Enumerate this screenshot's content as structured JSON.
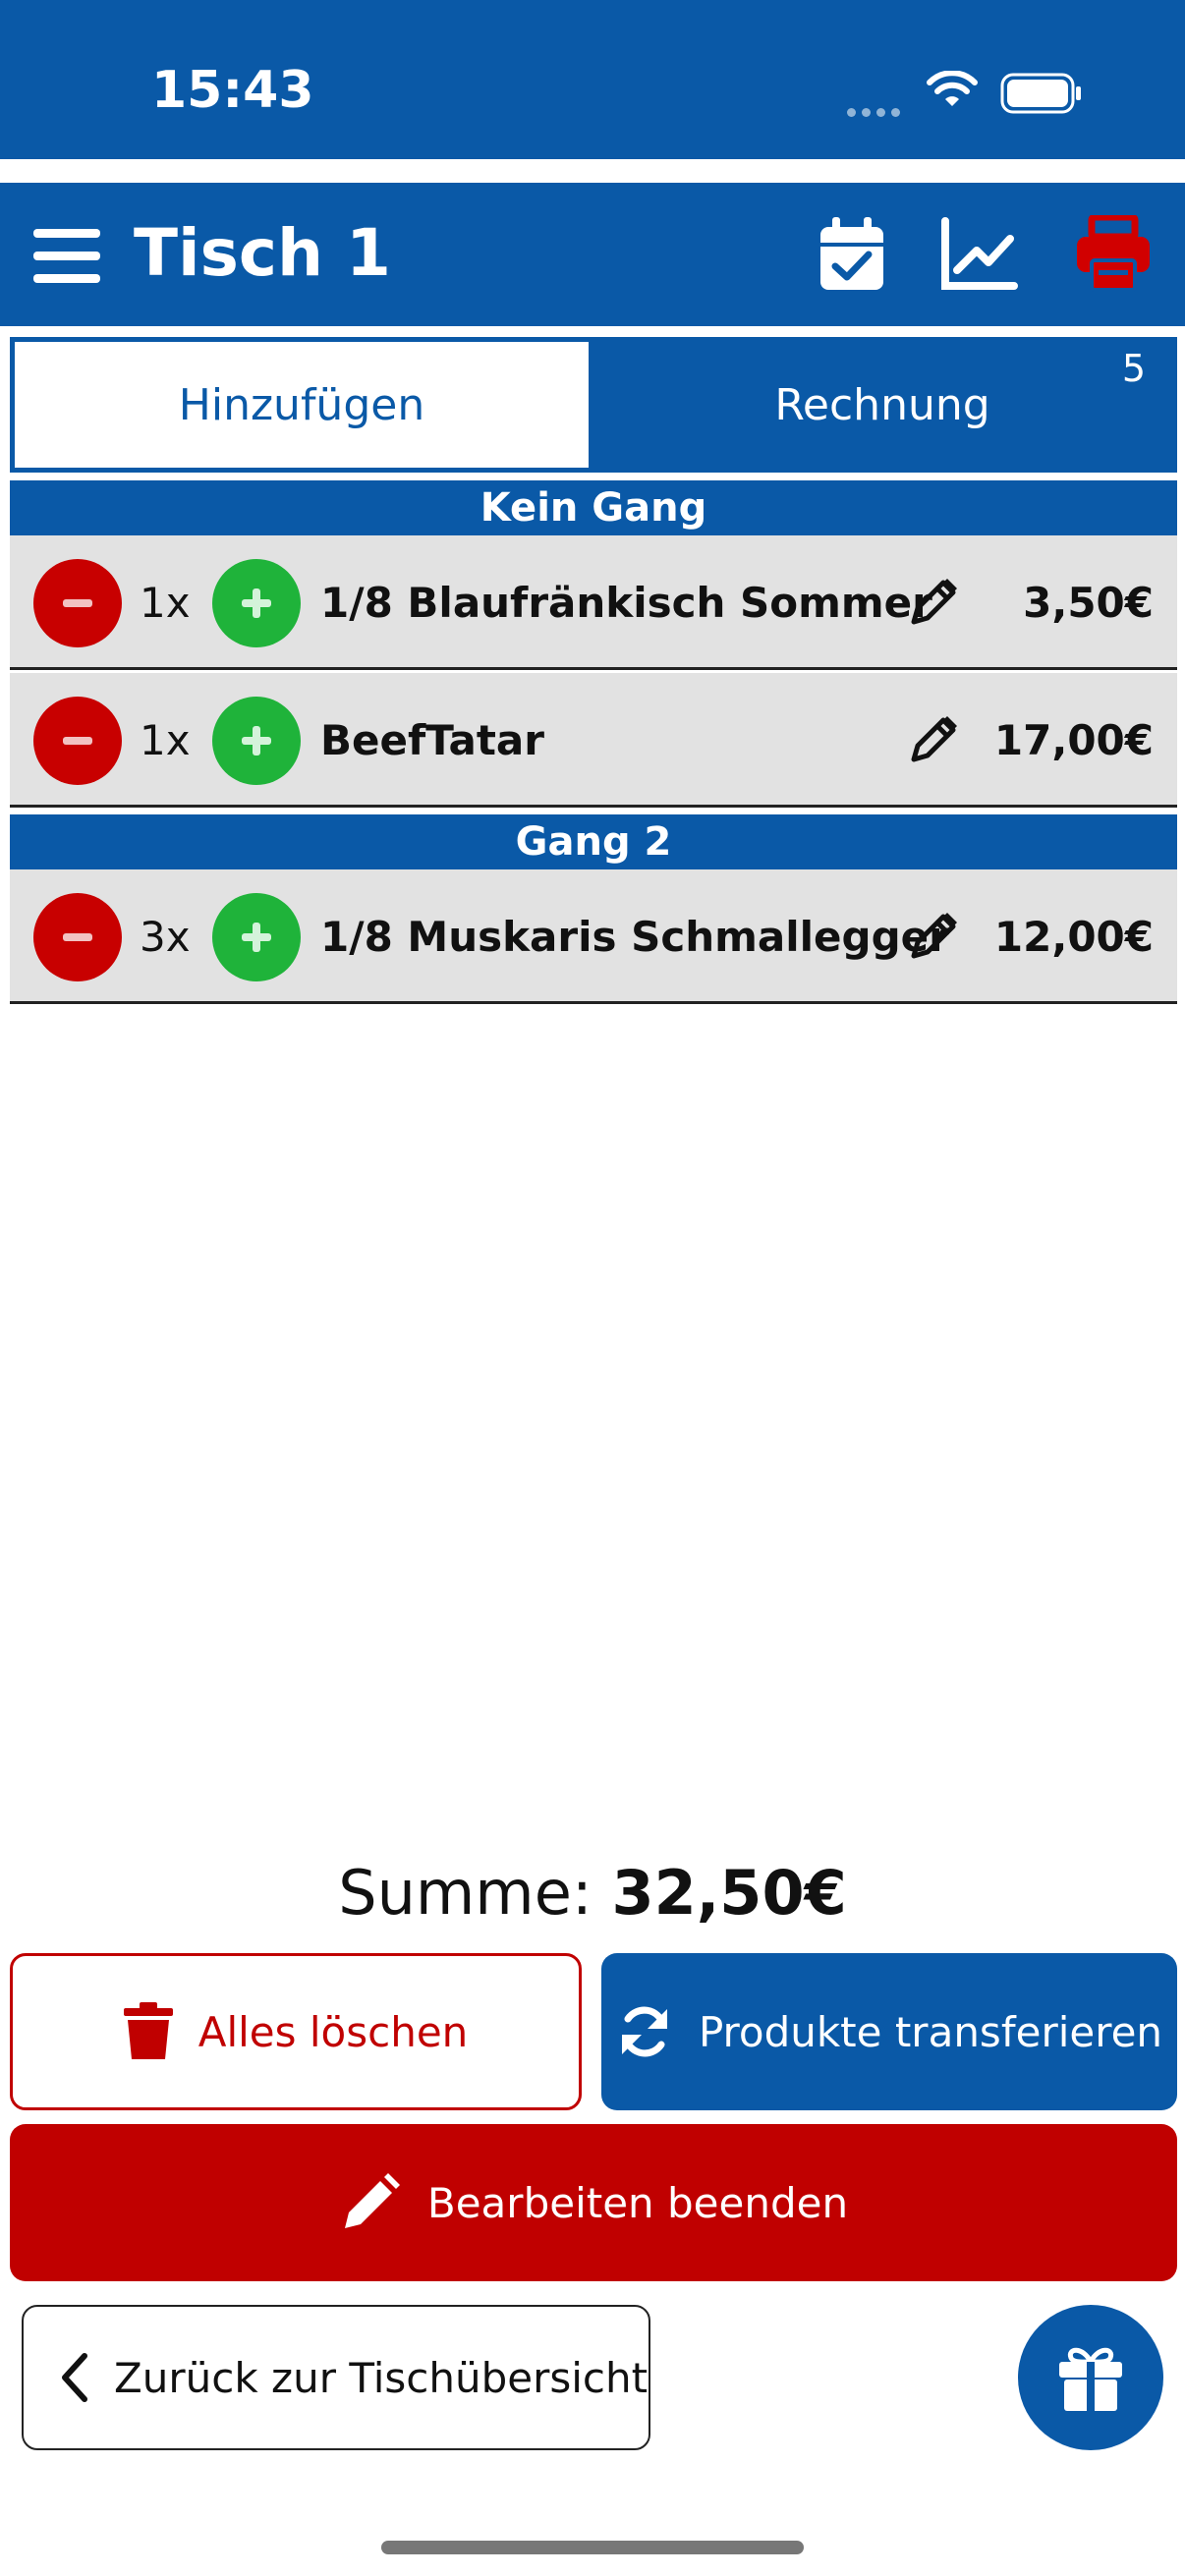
{
  "status_bar": {
    "time": "15:43"
  },
  "app_bar": {
    "title": "Tisch 1"
  },
  "tabs": [
    {
      "label": "Hinzufügen",
      "active": true
    },
    {
      "label": "Rechnung",
      "badge": "5"
    }
  ],
  "sections": [
    {
      "title": "Kein Gang",
      "items": [
        {
          "qty": "1x",
          "name": "1/8 Blaufränkisch Sommer",
          "price": "3,50€"
        },
        {
          "qty": "1x",
          "name": "BeefTatar",
          "price": "17,00€"
        }
      ]
    },
    {
      "title": "Gang 2",
      "items": [
        {
          "qty": "3x",
          "name": "1/8 Muskaris Schmallegger",
          "price": "12,00€"
        }
      ]
    }
  ],
  "summary": {
    "label": "Summe:",
    "value": "32,50€"
  },
  "actions": {
    "delete_all": "Alles löschen",
    "transfer": "Produkte transferieren",
    "finish_edit": "Bearbeiten beenden",
    "back": "Zurück zur Tischübersicht"
  },
  "colors": {
    "primary": "#0a59a7",
    "danger": "#c00000",
    "success": "#1fb33a",
    "row_bg": "#e2e2e2"
  },
  "icons": [
    "menu-icon",
    "calendar-check-icon",
    "chart-line-icon",
    "printer-icon",
    "minus-icon",
    "plus-icon",
    "pencil-icon",
    "trash-icon",
    "sync-icon",
    "chevron-left-icon",
    "gift-icon"
  ]
}
